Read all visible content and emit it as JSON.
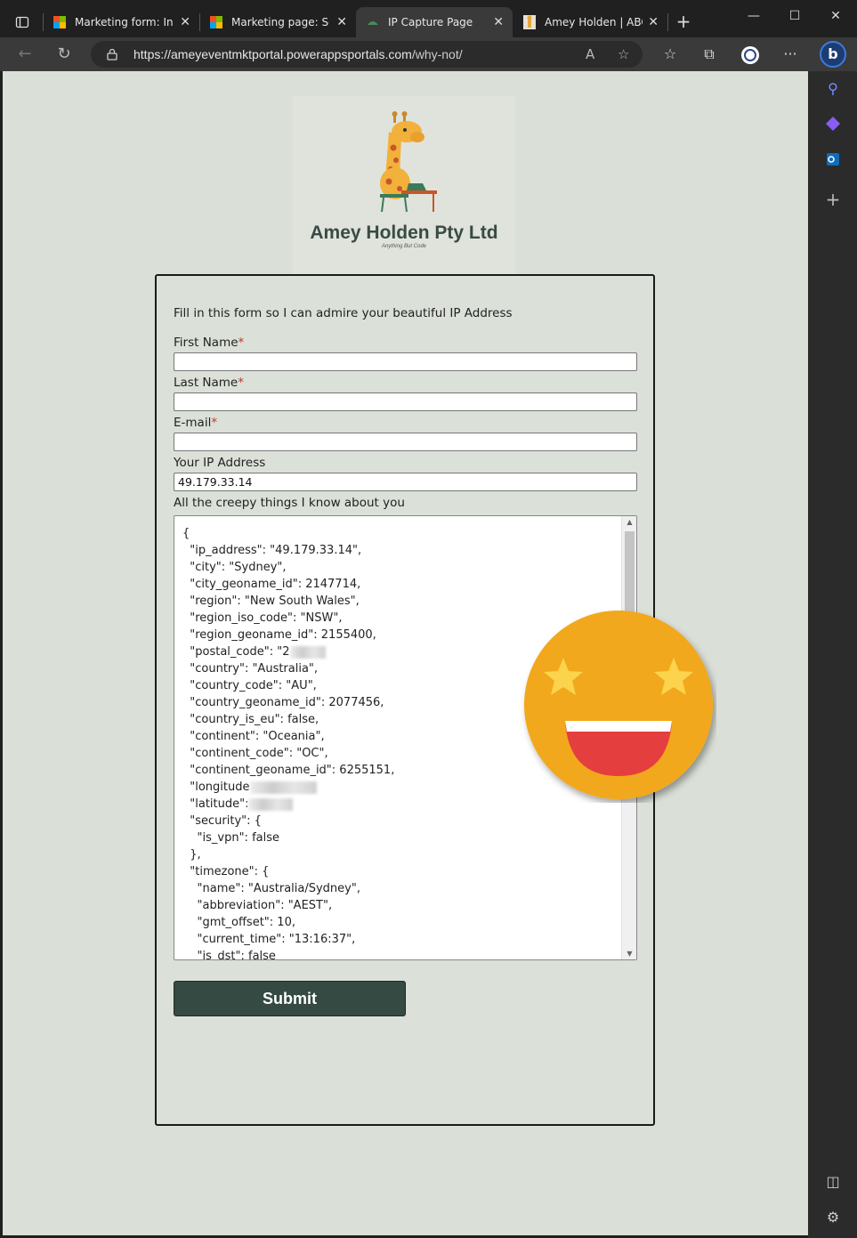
{
  "browser": {
    "tabs": [
      {
        "title": "Marketing form: Info",
        "icon": "microsoft-logo",
        "active": false
      },
      {
        "title": "Marketing page: Setu",
        "icon": "microsoft-logo",
        "active": false
      },
      {
        "title": "IP Capture Page",
        "icon": "site-logo",
        "active": true
      },
      {
        "title": "Amey Holden | ABC l",
        "icon": "giraffe-favicon",
        "active": false
      }
    ],
    "url_host": "https://ameyeventmktportal.powerappsportals.com",
    "url_path": "/why-not/"
  },
  "page": {
    "company_name": "Amey Holden Pty Ltd",
    "tagline": "Anything But Code",
    "intro": "Fill in this form so I can admire your beautiful IP Address",
    "fields": {
      "first_name_label": "First Name",
      "last_name_label": "Last Name",
      "email_label": "E-mail",
      "required_mark": "*",
      "ip_label": "Your IP Address",
      "ip_value": "49.179.33.14",
      "creepy_label": "All the creepy things I know about you"
    },
    "json_lines": [
      "{",
      "  \"ip_address\": \"49.179.33.14\",",
      "  \"city\": \"Sydney\",",
      "  \"city_geoname_id\": 2147714,",
      "  \"region\": \"New South Wales\",",
      "  \"region_iso_code\": \"NSW\",",
      "  \"region_geoname_id\": 2155400,",
      "  \"postal_code\": \"2",
      "  \"country\": \"Australia\",",
      "  \"country_code\": \"AU\",",
      "  \"country_geoname_id\": 2077456,",
      "  \"country_is_eu\": false,",
      "  \"continent\": \"Oceania\",",
      "  \"continent_code\": \"OC\",",
      "  \"continent_geoname_id\": 6255151,",
      "  \"longitude",
      "  \"latitude\":",
      "  \"security\": {",
      "    \"is_vpn\": false",
      "  },",
      "  \"timezone\": {",
      "    \"name\": \"Australia/Sydney\",",
      "    \"abbreviation\": \"AEST\",",
      "    \"gmt_offset\": 10,",
      "    \"current_time\": \"13:16:37\",",
      "    \"is_dst\": false"
    ],
    "submit_label": "Submit"
  },
  "colors": {
    "page_bg": "#dadfd7",
    "submit_bg": "#344a42",
    "required": "#c0392b",
    "emoji_face": "#f2a81d",
    "emoji_star": "#fcd34d",
    "emoji_mouth": "#e53e3e"
  }
}
